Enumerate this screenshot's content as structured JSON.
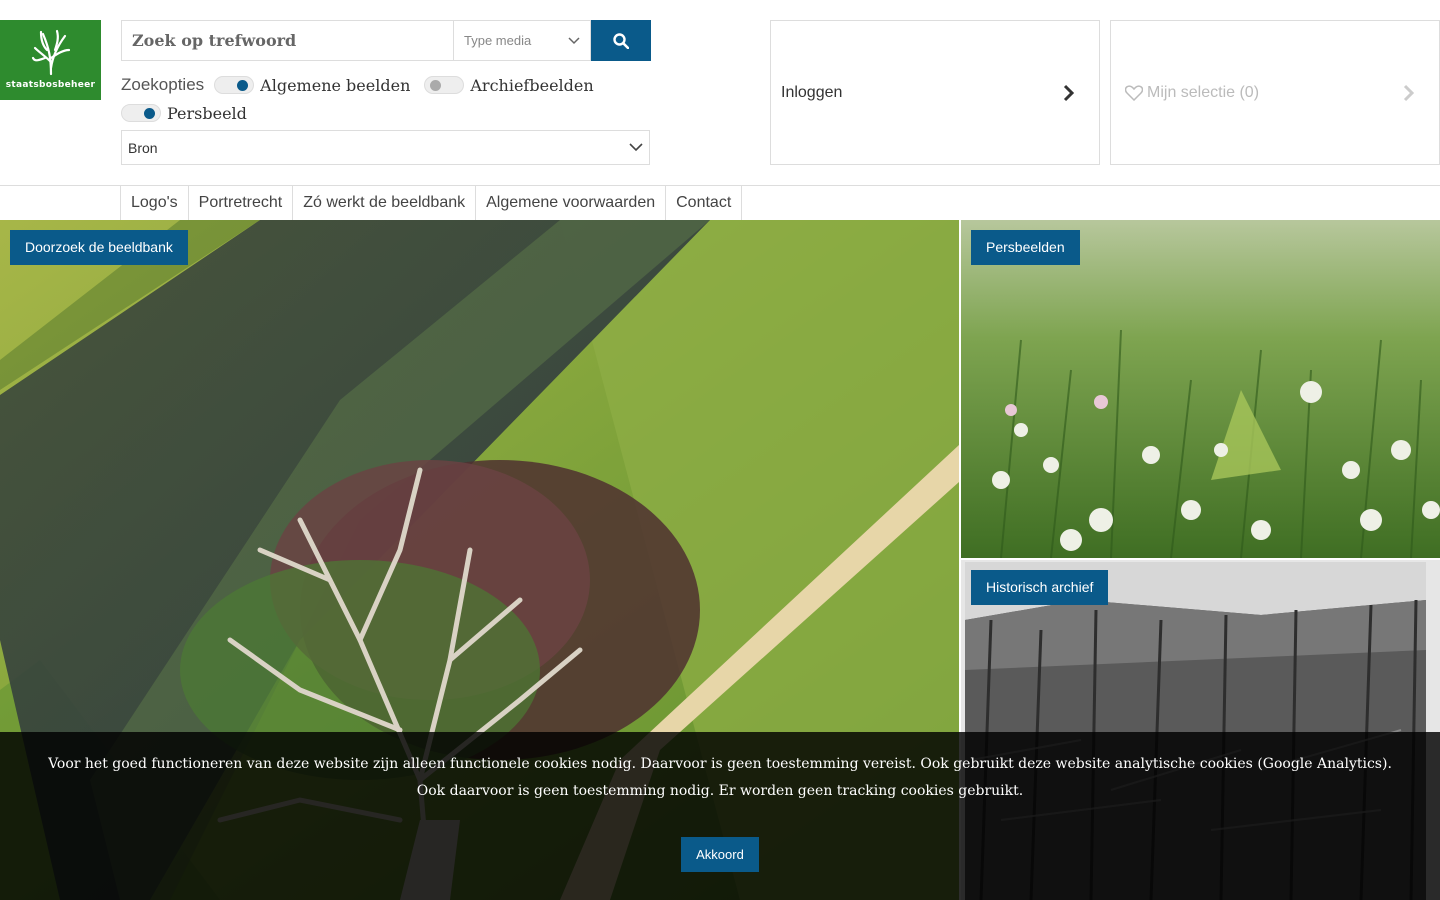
{
  "logo": {
    "text": "staatsbosbeheer",
    "color": "#2e8b2e"
  },
  "search": {
    "placeholder": "Zoek op trefwoord",
    "type_media": "Type media",
    "button_icon": "search-icon"
  },
  "zoekopties": {
    "label": "Zoekopties",
    "options": [
      {
        "label": "Algemene beelden",
        "on": true
      },
      {
        "label": "Archiefbeelden",
        "on": false
      },
      {
        "label": "Persbeeld",
        "on": true
      }
    ]
  },
  "bron": {
    "value": "Bron"
  },
  "account": {
    "login_label": "Inloggen",
    "selectie_label": "Mijn selectie (0)"
  },
  "nav": [
    "Logo's",
    "Portretrecht",
    "Zó werkt de beeldbank",
    "Algemene voorwaarden",
    "Contact"
  ],
  "tiles": {
    "main_label": "Doorzoek de beeldbank",
    "pers_label": "Persbeelden",
    "archief_label": "Historisch archief"
  },
  "cookie": {
    "text": "Voor het goed functioneren van deze website zijn alleen functionele cookies nodig. Daarvoor is geen toestemming vereist. Ook gebruikt deze website analytische cookies (Google Analytics). Ook daarvoor is geen toestemming nodig. Er worden geen tracking cookies gebruikt.",
    "button": "Akkoord"
  },
  "colors": {
    "accent": "#0a5a8a",
    "brand_green": "#2e8b2e"
  }
}
